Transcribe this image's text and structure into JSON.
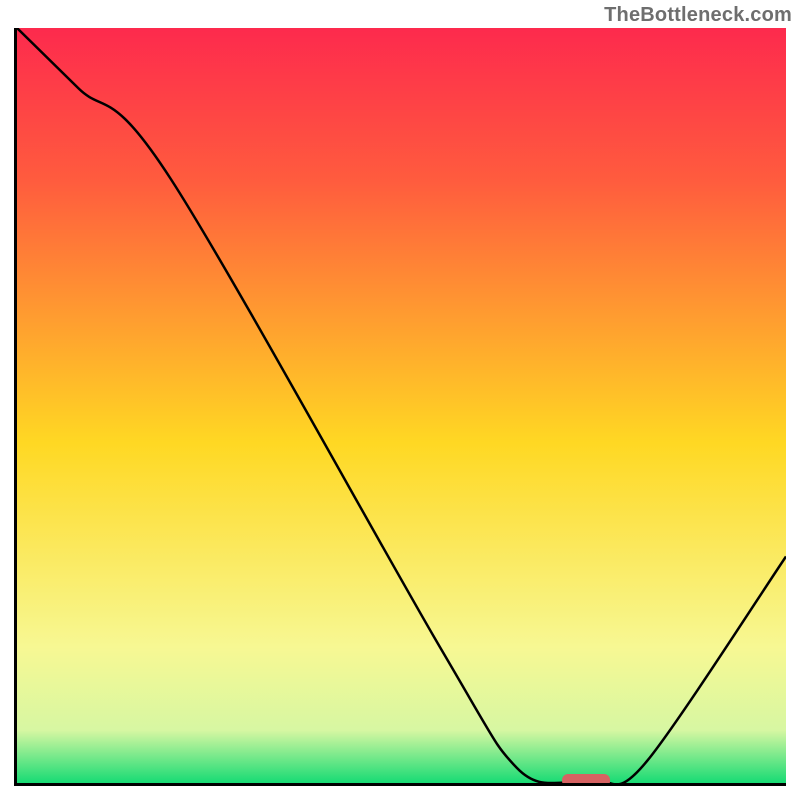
{
  "watermark": "TheBottleneck.com",
  "chart_data": {
    "type": "line",
    "title": "",
    "xlabel": "",
    "ylabel": "",
    "xlim": [
      0,
      100
    ],
    "ylim": [
      0,
      100
    ],
    "grid": false,
    "series": [
      {
        "name": "bottleneck-curve",
        "x": [
          0,
          8,
          20,
          55,
          65,
          72,
          76,
          82,
          100
        ],
        "values": [
          100,
          92,
          80,
          18,
          2,
          0,
          0,
          3,
          30
        ]
      }
    ],
    "annotations": [
      {
        "name": "optimal-marker",
        "x": 74,
        "y": 0,
        "color": "#d66262"
      }
    ],
    "background_gradient": {
      "top": "#fd2a4d",
      "mid": "#ffd823",
      "bottom": "#17db74"
    }
  }
}
